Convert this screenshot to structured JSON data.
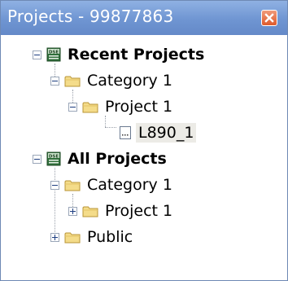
{
  "window": {
    "title": "Projects - 99877863",
    "close_icon": "close-x-icon"
  },
  "tree": {
    "recent": {
      "label": "Recent Projects",
      "icon": "dse-database-icon",
      "category": "Category 1",
      "project": "Project 1",
      "file": "L890_1"
    },
    "all": {
      "label": "All Projects",
      "icon": "dse-database-icon",
      "category": "Category 1",
      "project": "Project 1",
      "public": "Public"
    }
  }
}
